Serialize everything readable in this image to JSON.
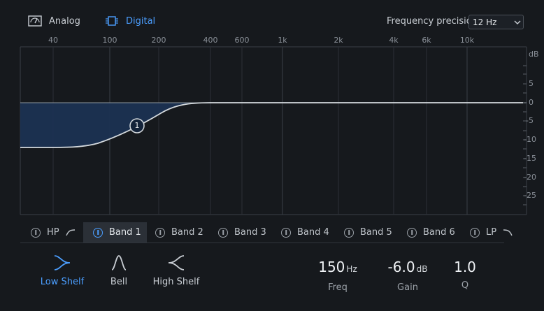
{
  "modes": {
    "analog": {
      "label": "Analog",
      "active": false
    },
    "digital": {
      "label": "Digital",
      "active": true
    }
  },
  "precision": {
    "label": "Frequency precision",
    "value": "12 Hz"
  },
  "graph": {
    "freq_ticks": [
      "40",
      "100",
      "200",
      "400",
      "600",
      "1k",
      "2k",
      "4k",
      "6k",
      "10k"
    ],
    "db_unit": "dB",
    "db_ticks": [
      "5",
      "0",
      "-5",
      "-10",
      "-15",
      "-20",
      "-25"
    ],
    "node_label": "1"
  },
  "bands": [
    {
      "label": "HP",
      "active": false
    },
    {
      "label": "Band 1",
      "active": true
    },
    {
      "label": "Band 2",
      "active": false
    },
    {
      "label": "Band 3",
      "active": false
    },
    {
      "label": "Band 4",
      "active": false
    },
    {
      "label": "Band 5",
      "active": false
    },
    {
      "label": "Band 6",
      "active": false
    },
    {
      "label": "LP",
      "active": false
    }
  ],
  "shapes": [
    {
      "label": "Low Shelf",
      "icon": "low-shelf-icon",
      "active": true
    },
    {
      "label": "Bell",
      "icon": "bell-icon",
      "active": false
    },
    {
      "label": "High Shelf",
      "icon": "high-shelf-icon",
      "active": false
    }
  ],
  "params": {
    "freq": {
      "value": "150",
      "unit": "Hz",
      "label": "Freq"
    },
    "gain": {
      "value": "-6.0",
      "unit": "dB",
      "label": "Gain"
    },
    "q": {
      "value": "1.0",
      "unit": "",
      "label": "Q"
    }
  },
  "colors": {
    "accent": "#4b9eff",
    "background": "#16191d",
    "fill": "#1b3152"
  }
}
